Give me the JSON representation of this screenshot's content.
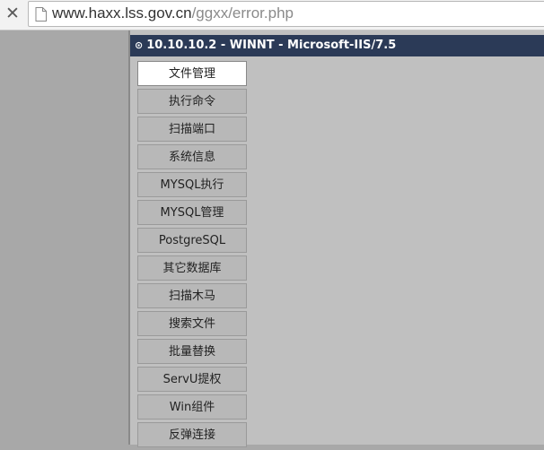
{
  "browser": {
    "close_glyph": "✕",
    "url_host": "www.haxx.lss.gov.cn",
    "url_path": "/ggxx/error.php"
  },
  "shell": {
    "title": "10.10.10.2 - WINNT - Microsoft-IIS/7.5",
    "title_icon": "⊙",
    "menu": [
      {
        "label": "文件管理",
        "active": true
      },
      {
        "label": "执行命令",
        "active": false
      },
      {
        "label": "扫描端口",
        "active": false
      },
      {
        "label": "系统信息",
        "active": false
      },
      {
        "label": "MYSQL执行",
        "active": false
      },
      {
        "label": "MYSQL管理",
        "active": false
      },
      {
        "label": "PostgreSQL",
        "active": false
      },
      {
        "label": "其它数据库",
        "active": false
      },
      {
        "label": "扫描木马",
        "active": false
      },
      {
        "label": "搜索文件",
        "active": false
      },
      {
        "label": "批量替换",
        "active": false
      },
      {
        "label": "ServU提权",
        "active": false
      },
      {
        "label": "Win组件",
        "active": false
      },
      {
        "label": "反弹连接",
        "active": false
      }
    ]
  }
}
